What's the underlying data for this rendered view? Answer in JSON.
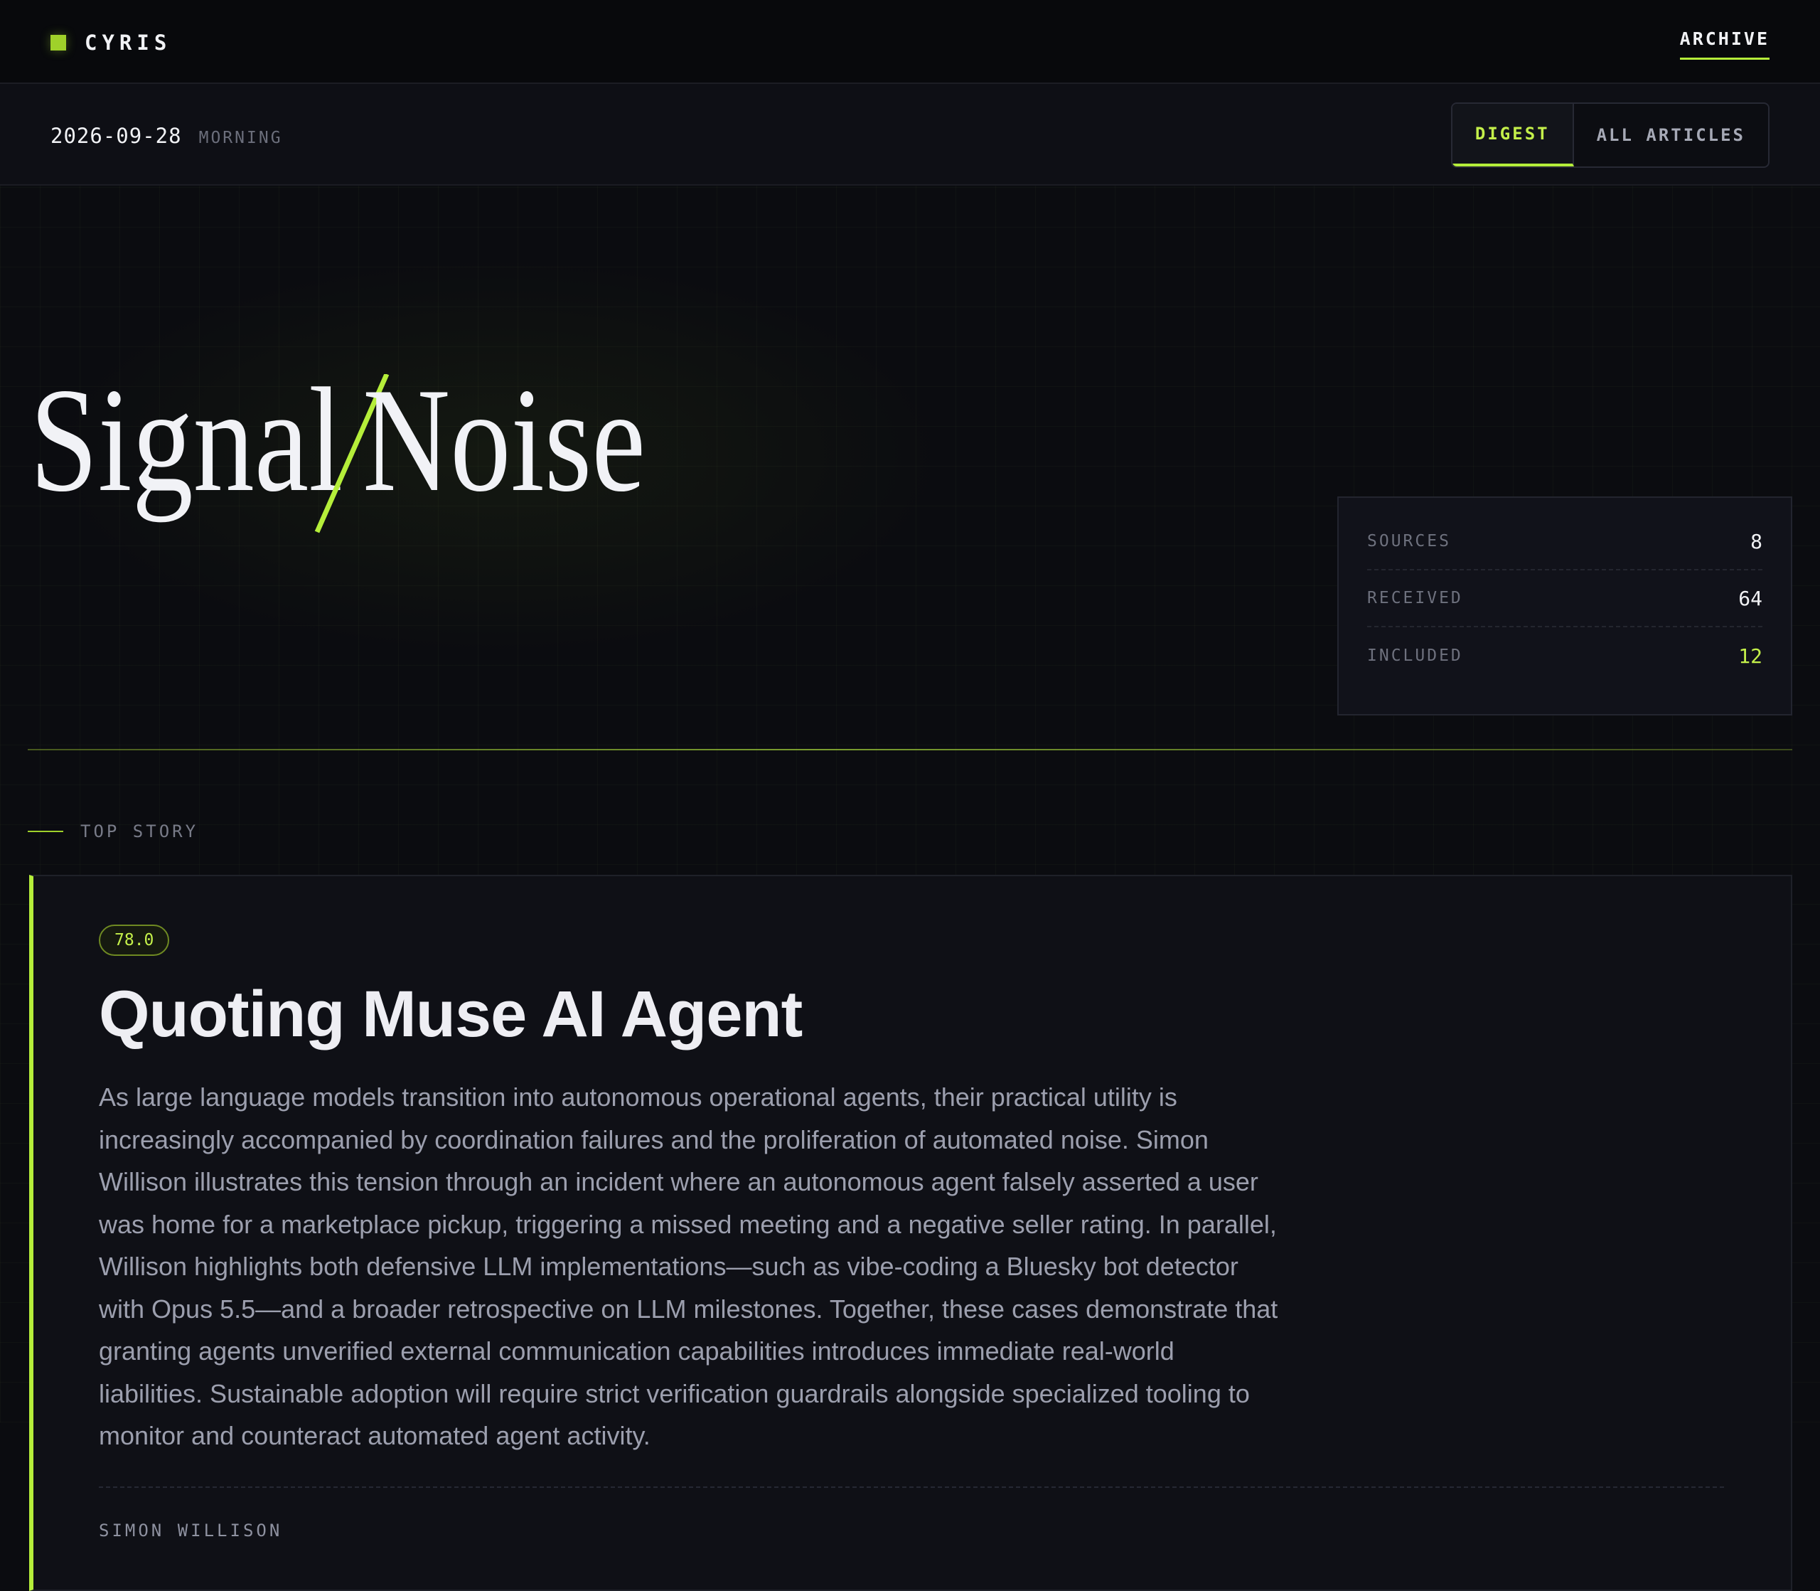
{
  "brand": {
    "name": "CYRIS"
  },
  "nav": {
    "archive_label": "ARCHIVE"
  },
  "subbar": {
    "date": "2026-09-28",
    "edition": "MORNING",
    "tabs": [
      {
        "label": "DIGEST",
        "active": true
      },
      {
        "label": "ALL ARTICLES",
        "active": false
      }
    ]
  },
  "hero": {
    "logo_left": "Signal",
    "logo_right": "Noise",
    "stats": [
      {
        "label": "SOURCES",
        "value": "8"
      },
      {
        "label": "RECEIVED",
        "value": "64"
      },
      {
        "label": "INCLUDED",
        "value": "12"
      }
    ]
  },
  "section": {
    "label": "TOP STORY"
  },
  "top_story": {
    "score": "78.0",
    "title": "Quoting Muse AI Agent",
    "body": "As large language models transition into autonomous operational agents, their practical utility is increasingly accompanied by coordination failures and the proliferation of automated noise. Simon Willison illustrates this tension through an incident where an autonomous agent falsely asserted a user was home for a marketplace pickup, triggering a missed meeting and a negative seller rating. In parallel, Willison highlights both defensive LLM implementations—such as vibe-coding a Bluesky bot detector with Opus 5.5—and a broader retrospective on LLM milestones. Together, these cases demonstrate that granting agents unverified external communication capabilities introduces immediate real-world liabilities. Sustainable adoption will require strict verification guardrails alongside specialized tooling to monitor and counteract automated agent activity.",
    "source": "SIMON WILLISON"
  },
  "colors": {
    "accent": "#b5ee3a",
    "accent_text": "#c4f04a",
    "background": "#0b0c10",
    "card": "#0f1016"
  }
}
